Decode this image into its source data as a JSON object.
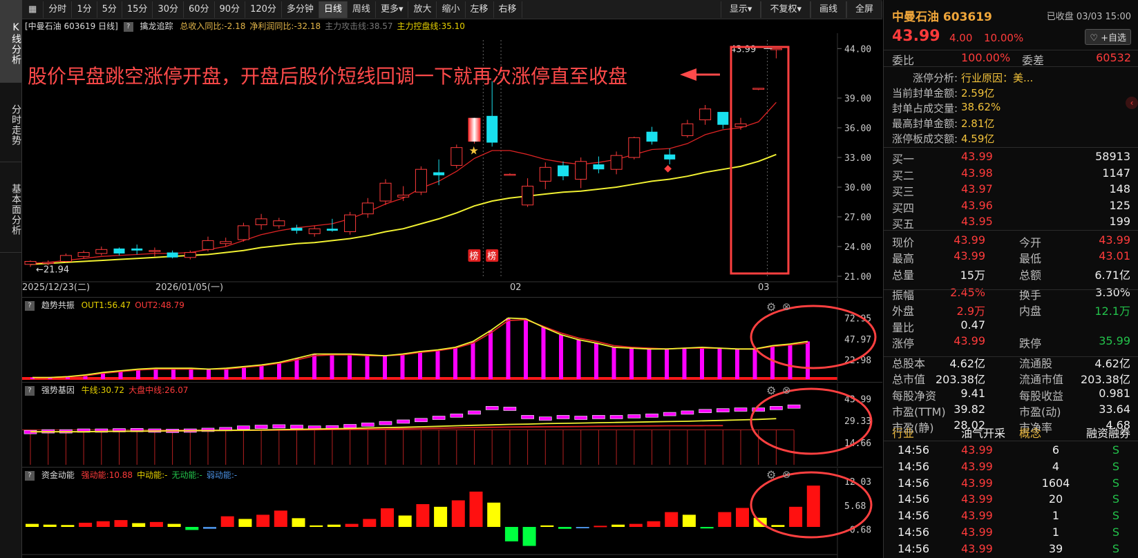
{
  "left_tabs": [
    {
      "label": "K线分析"
    },
    {
      "label": "分时走势"
    },
    {
      "label": "基本面分析"
    }
  ],
  "toolbar": {
    "left": [
      "分时",
      "1分",
      "5分",
      "15分",
      "30分",
      "60分",
      "90分",
      "120分",
      "多分钟",
      "日线",
      "周线",
      "更多▾",
      "放大",
      "缩小",
      "左移",
      "右移"
    ],
    "active": "日线",
    "right": [
      "显示▾",
      "不复权▾",
      "画线",
      "全屏"
    ]
  },
  "main_panel": {
    "title": "[中曼石油 603619 日线]",
    "indicator": "擒龙追踪",
    "fields": [
      {
        "text": "总收入同比:-2.18",
        "color": "#e3b64a"
      },
      {
        "text": "净利润同比:-32.18",
        "color": "#e3b64a"
      },
      {
        "text": "主力攻击线:38.57",
        "color": "#777777"
      },
      {
        "text": "主力控盘线:35.10",
        "color": "#e6d100"
      }
    ],
    "y_ticks": [
      "44.00",
      "39.00",
      "36.00",
      "33.00",
      "30.00",
      "27.00",
      "24.00",
      "21.00"
    ],
    "x_labels": [
      "2025/12/23(二)",
      "2026/01/05(一)",
      "02",
      "03"
    ],
    "min_label": "21.94",
    "max_label": "43.99",
    "annotation": "股价早盘跳空涨停开盘，开盘后股价短线回调一下就再次涨停直至收盘",
    "badge_label": "榜"
  },
  "panel2": {
    "title": "趋势共振",
    "fields": [
      {
        "text": "OUT1:56.47",
        "color": "#e6d100"
      },
      {
        "text": "OUT2:48.79",
        "color": "#ff3b3b"
      }
    ],
    "y_ticks": [
      "72.95",
      "47.97",
      "22.98"
    ]
  },
  "panel3": {
    "title": "强势基因",
    "fields": [
      {
        "text": "牛线:30.72",
        "color": "#e6d100"
      },
      {
        "text": "大盘中线:26.07",
        "color": "#ff3b3b"
      }
    ],
    "y_ticks": [
      "43.99",
      "29.33",
      "14.66"
    ]
  },
  "panel4": {
    "title": "资金动能",
    "fields": [
      {
        "text": "强动能:10.88",
        "color": "#ff3b3b"
      },
      {
        "text": "中动能:-",
        "color": "#e6d100"
      },
      {
        "text": "无动能:-",
        "color": "#23c24b"
      },
      {
        "text": "弱动能:-",
        "color": "#4a90e2"
      }
    ],
    "y_ticks": [
      "12.03",
      "5.68",
      "-0.68"
    ]
  },
  "chart_data": [
    {
      "type": "candlestick",
      "title": "中曼石油 603619 日线",
      "ylim": [
        21,
        45
      ],
      "series_names": [
        "主力攻击线",
        "主力控盘线"
      ],
      "candles": [
        {
          "o": 22.2,
          "h": 22.6,
          "l": 21.94,
          "c": 22.5
        },
        {
          "o": 22.3,
          "h": 22.6,
          "l": 22.1,
          "c": 22.4
        },
        {
          "o": 22.5,
          "h": 23.3,
          "l": 22.4,
          "c": 23.1
        },
        {
          "o": 23.0,
          "h": 23.6,
          "l": 22.8,
          "c": 23.4
        },
        {
          "o": 23.3,
          "h": 24.0,
          "l": 23.1,
          "c": 23.7
        },
        {
          "o": 23.8,
          "h": 23.9,
          "l": 23.1,
          "c": 23.3
        },
        {
          "o": 23.8,
          "h": 24.2,
          "l": 23.2,
          "c": 23.6
        },
        {
          "o": 23.5,
          "h": 23.9,
          "l": 23.0,
          "c": 23.6
        },
        {
          "o": 23.4,
          "h": 23.6,
          "l": 22.8,
          "c": 22.9
        },
        {
          "o": 22.9,
          "h": 23.6,
          "l": 22.7,
          "c": 23.4
        },
        {
          "o": 23.7,
          "h": 25.0,
          "l": 23.5,
          "c": 24.6
        },
        {
          "o": 24.3,
          "h": 24.9,
          "l": 24.0,
          "c": 24.5
        },
        {
          "o": 24.7,
          "h": 26.4,
          "l": 24.5,
          "c": 26.1
        },
        {
          "o": 26.2,
          "h": 27.3,
          "l": 25.7,
          "c": 26.8
        },
        {
          "o": 26.1,
          "h": 26.9,
          "l": 25.8,
          "c": 26.6
        },
        {
          "o": 25.9,
          "h": 26.2,
          "l": 25.3,
          "c": 25.6
        },
        {
          "o": 25.3,
          "h": 26.1,
          "l": 25.0,
          "c": 25.8
        },
        {
          "o": 25.8,
          "h": 26.8,
          "l": 25.5,
          "c": 25.6
        },
        {
          "o": 25.5,
          "h": 27.5,
          "l": 25.2,
          "c": 27.2
        },
        {
          "o": 27.3,
          "h": 28.9,
          "l": 26.9,
          "c": 28.4
        },
        {
          "o": 28.6,
          "h": 30.8,
          "l": 28.2,
          "c": 30.4
        },
        {
          "o": 29.0,
          "h": 30.1,
          "l": 28.6,
          "c": 29.2
        },
        {
          "o": 29.5,
          "h": 32.1,
          "l": 29.2,
          "c": 31.8
        },
        {
          "o": 31.5,
          "h": 32.8,
          "l": 30.2,
          "c": 31.2
        },
        {
          "o": 32.2,
          "h": 34.3,
          "l": 31.9,
          "c": 34.0
        },
        {
          "o": 34.6,
          "h": 37.0,
          "l": 34.4,
          "c": 37.0
        },
        {
          "o": 37.2,
          "h": 40.7,
          "l": 34.1,
          "c": 34.5
        },
        {
          "o": 31.3,
          "h": 31.4,
          "l": 31.2,
          "c": 31.3
        },
        {
          "o": 28.2,
          "h": 30.9,
          "l": 28.0,
          "c": 30.1
        },
        {
          "o": 30.6,
          "h": 32.5,
          "l": 29.8,
          "c": 32.0
        },
        {
          "o": 32.2,
          "h": 32.6,
          "l": 30.7,
          "c": 31.1
        },
        {
          "o": 30.8,
          "h": 33.0,
          "l": 29.9,
          "c": 32.6
        },
        {
          "o": 32.3,
          "h": 33.1,
          "l": 31.4,
          "c": 31.8
        },
        {
          "o": 31.8,
          "h": 33.6,
          "l": 31.3,
          "c": 33.2
        },
        {
          "o": 33.0,
          "h": 35.1,
          "l": 32.8,
          "c": 35.0
        },
        {
          "o": 35.6,
          "h": 36.1,
          "l": 34.3,
          "c": 34.6
        },
        {
          "o": 33.3,
          "h": 33.9,
          "l": 32.3,
          "c": 32.8
        },
        {
          "o": 35.2,
          "h": 36.8,
          "l": 35.0,
          "c": 36.4
        },
        {
          "o": 36.8,
          "h": 38.3,
          "l": 36.3,
          "c": 37.9
        },
        {
          "o": 37.6,
          "h": 37.6,
          "l": 35.9,
          "c": 36.3
        },
        {
          "o": 36.1,
          "h": 37.0,
          "l": 35.8,
          "c": 36.4
        },
        {
          "o": 39.9,
          "h": 39.99,
          "l": 39.8,
          "c": 39.99
        },
        {
          "o": 43.99,
          "h": 43.99,
          "l": 43.01,
          "c": 43.99
        }
      ],
      "ma_attack": [
        22.3,
        22.4,
        22.6,
        22.8,
        23.0,
        23.1,
        23.2,
        23.3,
        23.3,
        23.4,
        23.7,
        24.0,
        24.6,
        25.2,
        25.6,
        25.9,
        26.1,
        26.3,
        26.8,
        27.5,
        28.3,
        28.9,
        29.9,
        30.6,
        31.6,
        32.9,
        33.7,
        33.7,
        33.3,
        32.8,
        32.5,
        32.3,
        32.5,
        32.8,
        33.3,
        33.8,
        33.9,
        34.4,
        35.3,
        35.8,
        36.0,
        36.6,
        38.57
      ],
      "ma_control": [
        22.2,
        22.3,
        22.4,
        22.5,
        22.6,
        22.7,
        22.8,
        22.9,
        23.0,
        23.1,
        23.2,
        23.4,
        23.6,
        23.9,
        24.1,
        24.3,
        24.4,
        24.6,
        24.8,
        25.1,
        25.5,
        25.8,
        26.3,
        26.8,
        27.4,
        28.1,
        28.6,
        28.9,
        29.1,
        29.3,
        29.5,
        29.6,
        29.8,
        30.0,
        30.3,
        30.6,
        30.8,
        31.1,
        31.5,
        31.8,
        32.1,
        32.6,
        33.3
      ],
      "marks": [
        {
          "index": 25,
          "type": "star"
        },
        {
          "index": 25,
          "type": "badge"
        },
        {
          "index": 26,
          "type": "badge"
        },
        {
          "index": 36,
          "type": "diamond"
        }
      ]
    },
    {
      "type": "bar",
      "title": "趋势共振",
      "ylim": [
        0,
        80
      ],
      "series": [
        {
          "name": "OUT1",
          "values": [
            2,
            2,
            3,
            5,
            8,
            10,
            12,
            13,
            13,
            13,
            12,
            13,
            15,
            17,
            20,
            25,
            30,
            30,
            30,
            29,
            28,
            30,
            33,
            35,
            38,
            45,
            58,
            73,
            72,
            62,
            53,
            47,
            43,
            38,
            37,
            36,
            36,
            37,
            38,
            37,
            36,
            36,
            40,
            42,
            45,
            49,
            52,
            54,
            56.47
          ]
        },
        {
          "name": "OUT2",
          "values": [
            2,
            2,
            3,
            4,
            7,
            9,
            11,
            12,
            12,
            12,
            12,
            12,
            14,
            16,
            19,
            23,
            28,
            29,
            29,
            28,
            28,
            29,
            32,
            34,
            37,
            43,
            55,
            70,
            71,
            63,
            55,
            49,
            45,
            40,
            38,
            37,
            36,
            37,
            37,
            37,
            36,
            36,
            39,
            41,
            43,
            46,
            48,
            48,
            48.79
          ]
        }
      ]
    },
    {
      "type": "bar",
      "title": "强势基因",
      "ylim": [
        0,
        46
      ],
      "series": [
        {
          "name": "牛线",
          "values": [
            22,
            22,
            22,
            22,
            22.2,
            22.3,
            22.4,
            22.5,
            22.6,
            22.7,
            22.8,
            22.9,
            23,
            23.2,
            23.4,
            23.6,
            23.8,
            24,
            24.2,
            24.5,
            24.8,
            25,
            25.3,
            25.6,
            26,
            26.3,
            26.6,
            26.9,
            27.1,
            27.4,
            27.6,
            27.8,
            28,
            28.2,
            28.4,
            28.6,
            28.8,
            29,
            29.3,
            29.6,
            29.9,
            30.2,
            30.72
          ]
        },
        {
          "name": "大盘中线",
          "values": [
            22,
            22,
            22,
            22,
            22.1,
            22.2,
            22.3,
            22.4,
            22.5,
            22.6,
            22.7,
            22.8,
            22.9,
            23,
            23.1,
            23.2,
            23.3,
            23.4,
            23.5,
            23.6,
            23.8,
            24,
            24.2,
            24.4,
            24.6,
            24.8,
            25,
            25.1,
            25.2,
            25.3,
            25.4,
            25.5,
            25.6,
            25.7,
            25.8,
            25.9,
            26,
            26,
            26.05,
            26.07
          ]
        },
        {
          "name": "boxes",
          "values": [
            22,
            22.5,
            22.5,
            23,
            23,
            23.2,
            23.3,
            23,
            22.8,
            23,
            23.5,
            24,
            25,
            25.5,
            25.8,
            25.5,
            25,
            25.2,
            26,
            27,
            28,
            29,
            30,
            31.5,
            33,
            35,
            38,
            37.5,
            32,
            31,
            32,
            31.5,
            32,
            32,
            32.5,
            33,
            34,
            35,
            36,
            36.5,
            37,
            37,
            38,
            39,
            40,
            41,
            42,
            43.5,
            44
          ]
        }
      ]
    },
    {
      "type": "bar",
      "title": "资金动能",
      "ylim": [
        -5,
        13
      ],
      "series": [
        {
          "name": "values",
          "values": [
            0.8,
            0.6,
            0.5,
            1.1,
            1.5,
            1.8,
            1.0,
            1.3,
            0.8,
            -0.8,
            -0.5,
            2.8,
            2.1,
            3.2,
            4.3,
            2.3,
            0.4,
            0.6,
            0.8,
            2.1,
            4.9,
            3.0,
            6.0,
            5.3,
            7.0,
            9.3,
            6.4,
            -3.8,
            -5.0,
            0.4,
            -0.5,
            -0.3,
            0.3,
            0.6,
            0.8,
            1.5,
            3.9,
            3.2,
            -0.4,
            3.9,
            5.0,
            2.4,
            0.5,
            5.3,
            10.88
          ]
        },
        {
          "name": "colors",
          "values": [
            "y",
            "y",
            "y",
            "r",
            "r",
            "r",
            "y",
            "r",
            "y",
            "g",
            "b",
            "r",
            "y",
            "r",
            "r",
            "y",
            "y",
            "y",
            "r",
            "r",
            "r",
            "y",
            "r",
            "y",
            "r",
            "r",
            "y",
            "g",
            "g",
            "y",
            "g",
            "b",
            "r",
            "y",
            "r",
            "r",
            "r",
            "y",
            "g",
            "r",
            "r",
            "y",
            "y",
            "r",
            "r"
          ]
        }
      ]
    }
  ],
  "quote": {
    "name": "中曼石油 603619",
    "status": "已收盘 03/03 15:00",
    "price": "43.99",
    "change": "4.00",
    "pct": "10.00%",
    "add_fav": "♡ +自选",
    "weibi_label": "委比",
    "weibi": "100.00%",
    "weicha_label": "委差",
    "weicha": "60532",
    "limit": [
      {
        "label": "涨停分析:",
        "value": "行业原因：美..."
      },
      {
        "label": "当前封单金额:",
        "value": "2.59亿"
      },
      {
        "label": "封单占成交量:",
        "value": "38.62%"
      },
      {
        "label": "最高封单金额:",
        "value": "2.81亿"
      },
      {
        "label": "涨停板成交额:",
        "value": "4.59亿"
      }
    ],
    "bids": [
      {
        "label": "买一",
        "price": "43.99",
        "vol": "58913"
      },
      {
        "label": "买二",
        "price": "43.98",
        "vol": "1147"
      },
      {
        "label": "买三",
        "price": "43.97",
        "vol": "148"
      },
      {
        "label": "买四",
        "price": "43.96",
        "vol": "125"
      },
      {
        "label": "买五",
        "price": "43.95",
        "vol": "199"
      }
    ],
    "stats": [
      {
        "l1": "现价",
        "v1": "43.99",
        "c1": "red",
        "l2": "今开",
        "v2": "43.99",
        "c2": "red"
      },
      {
        "l1": "最高",
        "v1": "43.99",
        "c1": "red",
        "l2": "最低",
        "v2": "43.01",
        "c2": "red"
      },
      {
        "l1": "总量",
        "v1": "15万",
        "c1": "white",
        "l2": "总额",
        "v2": "6.71亿",
        "c2": "white"
      },
      {
        "l1": "振幅",
        "v1": "2.45%",
        "c1": "red",
        "l2": "换手",
        "v2": "3.30%",
        "c2": "white"
      },
      {
        "l1": "外盘",
        "v1": "2.9万",
        "c1": "red",
        "l2": "内盘",
        "v2": "12.1万",
        "c2": "green"
      },
      {
        "l1": "量比",
        "v1": "0.47",
        "c1": "white",
        "l2": "",
        "v2": "",
        "c2": "white"
      },
      {
        "l1": "涨停",
        "v1": "43.99",
        "c1": "red",
        "l2": "跌停",
        "v2": "35.99",
        "c2": "green"
      },
      {
        "l1": "总股本",
        "v1": "4.62亿",
        "c1": "white",
        "l2": "流通股",
        "v2": "4.62亿",
        "c2": "white"
      },
      {
        "l1": "总市值",
        "v1": "203.38亿",
        "c1": "white",
        "l2": "流通市值",
        "v2": "203.38亿",
        "c2": "white"
      },
      {
        "l1": "每股净资",
        "v1": "9.41",
        "c1": "white",
        "l2": "每股收益",
        "v2": "0.981",
        "c2": "white"
      },
      {
        "l1": "市盈(TTM)",
        "v1": "39.82",
        "c1": "white",
        "l2": "市盈(动)",
        "v2": "33.64",
        "c2": "white"
      },
      {
        "l1": "市盈(静)",
        "v1": "28.02",
        "c1": "white",
        "l2": "市净率",
        "v2": "4.68",
        "c2": "white"
      }
    ],
    "industry": {
      "l1": "行业",
      "v1": "油气开采",
      "l2": "概念",
      "v2": "融资融券"
    },
    "ticks": [
      {
        "time": "14:56",
        "price": "43.99",
        "vol": "6",
        "side": "S"
      },
      {
        "time": "14:56",
        "price": "43.99",
        "vol": "4",
        "side": "S"
      },
      {
        "time": "14:56",
        "price": "43.99",
        "vol": "1604",
        "side": "S"
      },
      {
        "time": "14:56",
        "price": "43.99",
        "vol": "20",
        "side": "S"
      },
      {
        "time": "14:56",
        "price": "43.99",
        "vol": "1",
        "side": "S"
      },
      {
        "time": "14:56",
        "price": "43.99",
        "vol": "1",
        "side": "S"
      },
      {
        "time": "14:56",
        "price": "43.99",
        "vol": "39",
        "side": "S"
      }
    ]
  },
  "colors": {
    "up": "#ff3b3b",
    "down": "#19e0ee",
    "ma_red": "#e02424",
    "ma_yellow": "#f1f132",
    "magenta": "#ff00ff",
    "bg": "#000000",
    "grid": "#2a2a2a"
  }
}
